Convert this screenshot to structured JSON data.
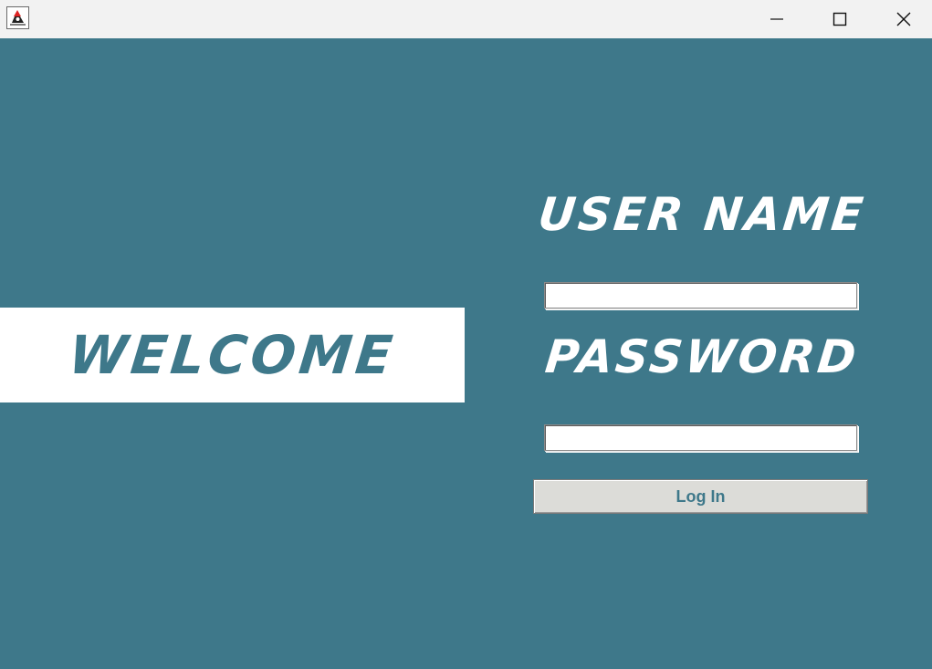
{
  "window": {
    "icon": "java-duke-icon",
    "controls": [
      "minimize-icon",
      "maximize-icon",
      "close-icon"
    ]
  },
  "welcome": {
    "text": "WELCOME"
  },
  "form": {
    "username_label": "USER NAME",
    "username_value": "",
    "password_label": "PASSWORD",
    "password_value": "",
    "login_label": "Log In"
  },
  "colors": {
    "background": "#3e788a",
    "panel": "#ffffff",
    "titlebar": "#f2f2f2",
    "button": "#dcdcd8"
  }
}
